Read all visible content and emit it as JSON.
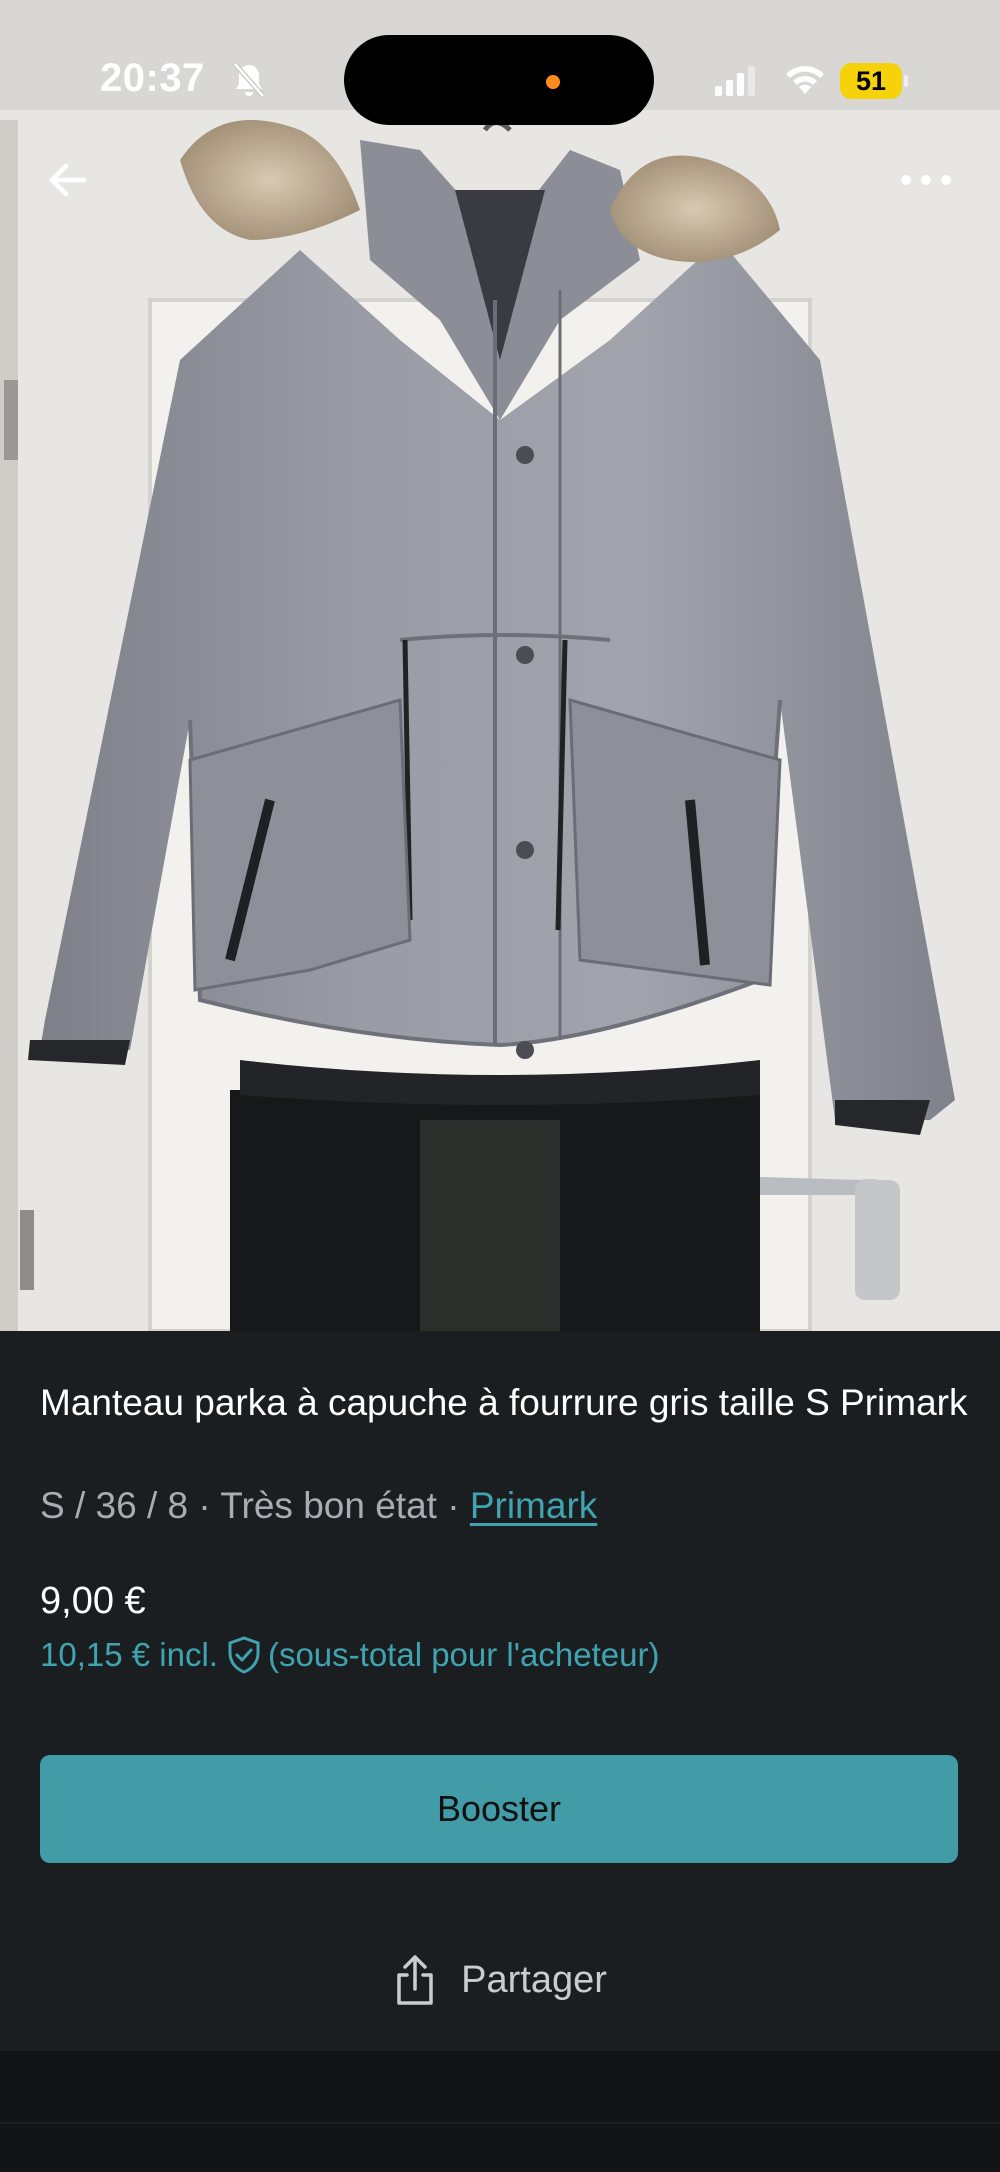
{
  "status_bar": {
    "time": "20:37",
    "battery": "51"
  },
  "listing": {
    "title": "Manteau parka à capuche à fourrure gris taille S Primark",
    "meta_prefix": "S / 36 / 8 · Très bon état · ",
    "brand": "Primark",
    "price": "9,00 €",
    "buyer_price": "10,15 € incl.",
    "buyer_note": "(sous-total pour l'acheteur)"
  },
  "actions": {
    "booster_label": "Booster",
    "share_label": "Partager"
  },
  "icons": [
    "back-arrow-icon",
    "more-options-icon",
    "bell-muted-icon",
    "signal-icon",
    "wifi-icon",
    "shield-check-icon",
    "share-icon"
  ],
  "colors": {
    "accent": "#3fa4af",
    "button": "#419ca7",
    "background": "#1b1e20"
  }
}
